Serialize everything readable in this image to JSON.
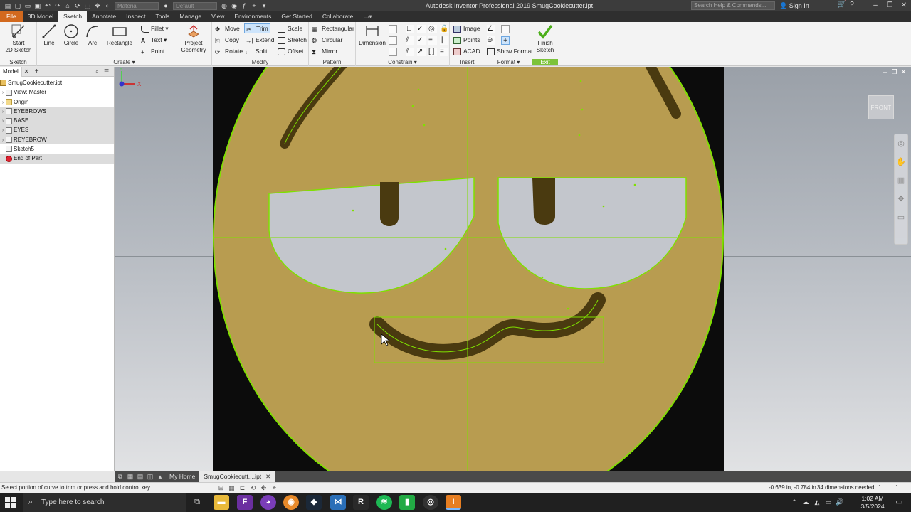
{
  "titlebar": {
    "material": "Material",
    "appearance": "Default",
    "title": "Autodesk Inventor Professional 2019   SmugCookiecutter.ipt",
    "search_placeholder": "Search Help & Commands...",
    "sign_in": "Sign In"
  },
  "tabs": [
    "File",
    "3D Model",
    "Sketch",
    "Annotate",
    "Inspect",
    "Tools",
    "Manage",
    "View",
    "Environments",
    "Get Started",
    "Collaborate"
  ],
  "ribbon": {
    "sketch_panel": {
      "start": "Start",
      "start2": "2D Sketch",
      "label": "Sketch"
    },
    "create_panel": {
      "line": "Line",
      "circle": "Circle",
      "arc": "Arc",
      "rectangle": "Rectangle",
      "fillet": "Fillet",
      "text": "Text",
      "point": "Point",
      "project": "Project",
      "project2": "Geometry",
      "label": "Create"
    },
    "modify_panel": {
      "move": "Move",
      "trim": "Trim",
      "scale": "Scale",
      "copy": "Copy",
      "extend": "Extend",
      "stretch": "Stretch",
      "rotate": "Rotate",
      "split": "Split",
      "offset": "Offset",
      "label": "Modify"
    },
    "pattern_panel": {
      "rectangular": "Rectangular",
      "circular": "Circular",
      "mirror": "Mirror",
      "label": "Pattern"
    },
    "constrain_panel": {
      "dimension": "Dimension",
      "label": "Constrain"
    },
    "insert_panel": {
      "image": "Image",
      "points": "Points",
      "acad": "ACAD",
      "label": "Insert"
    },
    "format_panel": {
      "show_format": "Show Format",
      "label": "Format"
    },
    "exit_panel": {
      "finish": "Finish",
      "finish2": "Sketch",
      "label": "Exit"
    }
  },
  "browser": {
    "tab": "Model",
    "items": [
      {
        "label": "SmugCookiecutter.ipt",
        "icon": "part-icon"
      },
      {
        "label": "View: Master",
        "icon": "view-icon"
      },
      {
        "label": "Origin",
        "icon": "folder-icon"
      },
      {
        "label": "EYEBROWS",
        "icon": "extrusion-icon"
      },
      {
        "label": "BASE",
        "icon": "extrusion-icon"
      },
      {
        "label": "EYES",
        "icon": "extrusion-icon"
      },
      {
        "label": "REYEBROW",
        "icon": "extrusion-icon"
      },
      {
        "label": "Sketch5",
        "icon": "sketch-icon"
      },
      {
        "label": "End of Part",
        "icon": "end-of-part-icon"
      }
    ]
  },
  "viewport": {
    "viewcube": "FRONT",
    "axis_x": "X",
    "axis_y": "Y"
  },
  "doctabs": {
    "home": "My Home",
    "doc": "SmugCookiecutt....ipt"
  },
  "status": {
    "message": "Select portion of curve to trim or press and hold control key",
    "coords": "-0.639 in, -0.784 in",
    "dims": "34 dimensions needed",
    "n1": "1",
    "n2": "1"
  },
  "taskbar": {
    "search": "Type here to search",
    "time": "1:02 AM",
    "date": "3/5/2024"
  },
  "colors": {
    "sketch_green": "#7fe000",
    "face_gold": "#b89c50",
    "eye_grey": "#c3c6cc",
    "feature_dark": "#4a3a10",
    "ribbon_bg": "#f3f3f3",
    "file_tab": "#d2691e"
  }
}
